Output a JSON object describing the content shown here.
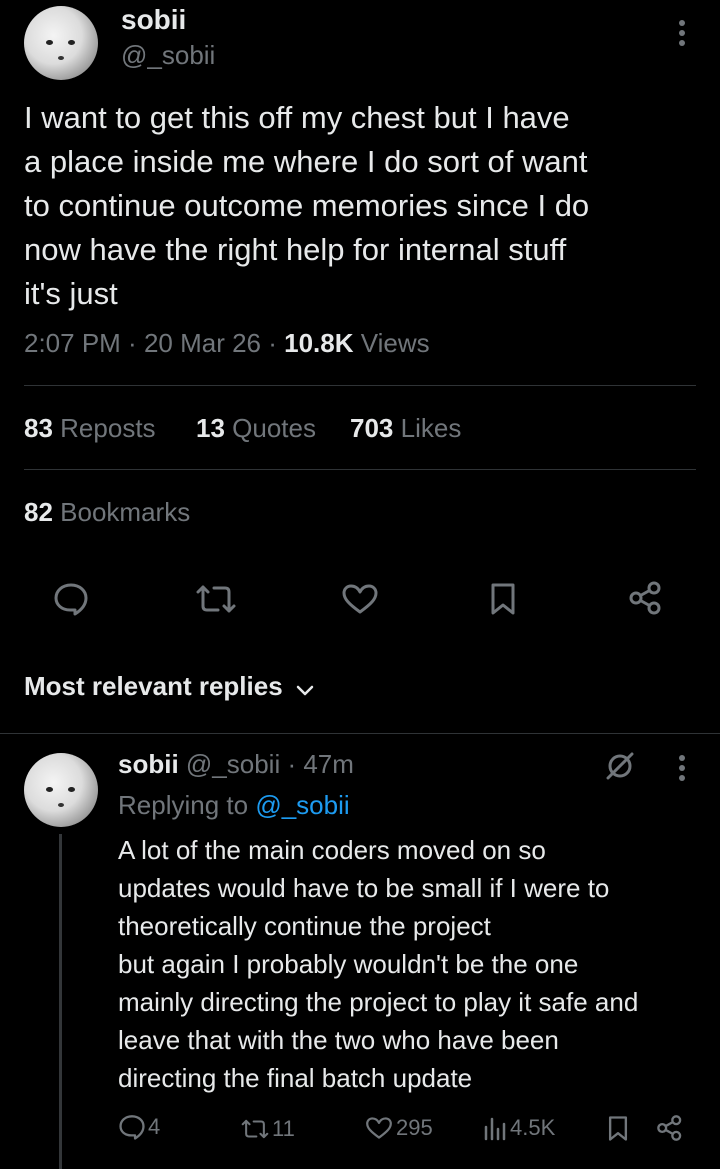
{
  "tweet": {
    "author_name": "sobii",
    "author_handle": "@_sobii",
    "text_lines": [
      "I want to get this off my chest but I have",
      "a place inside me where I do sort of want",
      "to continue outcome memories since I do",
      "now have the right help for internal stuff",
      "it's just"
    ],
    "time": "2:07 PM",
    "date": "20 Mar 26",
    "views_count": "10.8K",
    "views_label": "Views",
    "reposts_count": "83",
    "reposts_label": "Reposts",
    "quotes_count": "13",
    "quotes_label": "Quotes",
    "likes_count": "703",
    "likes_label": "Likes",
    "bookmarks_count": "82",
    "bookmarks_label": "Bookmarks"
  },
  "replies_header": {
    "label": "Most relevant replies"
  },
  "reply": {
    "author_name": "sobii",
    "author_handle": "@_sobii",
    "age": "47m",
    "replying_to_label": "Replying to",
    "replying_to_handle": "@_sobii",
    "text_lines": [
      "A lot of the main coders moved on so",
      "updates would have to be small if I were to",
      "theoretically continue the project",
      "but again I probably wouldn't be the one",
      "mainly directing the project to play it safe and",
      "leave that with the two who have been",
      "directing the final batch update"
    ],
    "replies_count": "4",
    "reposts_count": "11",
    "likes_count": "295",
    "views_count": "4.5K"
  },
  "colors": {
    "background": "#000000",
    "text": "#e7e9ea",
    "muted": "#71767b",
    "link": "#1d9bf0",
    "divider": "#2f3336"
  },
  "icons": [
    "more-icon",
    "reply-icon",
    "repost-icon",
    "like-icon",
    "bookmark-icon",
    "share-icon",
    "chevron-down-icon",
    "grok-icon",
    "views-icon"
  ]
}
